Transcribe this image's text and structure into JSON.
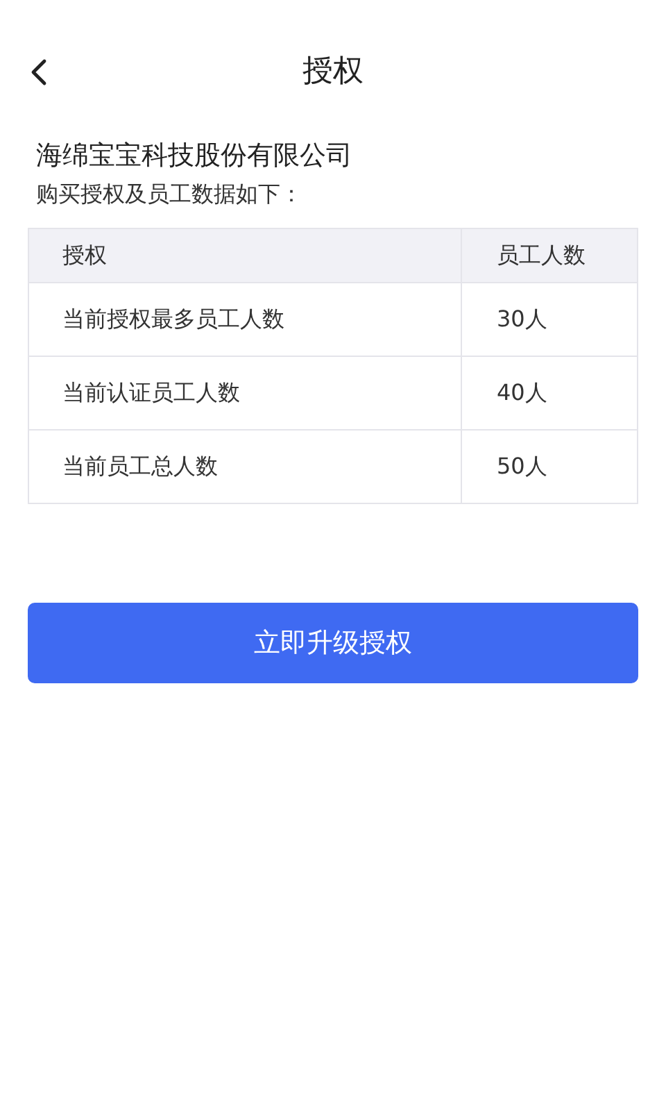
{
  "header": {
    "title": "授权"
  },
  "company": "海绵宝宝科技股份有限公司",
  "intro": "购买授权及员工数据如下：",
  "table": {
    "columns": [
      "授权",
      "员工人数"
    ],
    "rows": [
      [
        "当前授权最多员工人数",
        "30人"
      ],
      [
        "当前认证员工人数",
        "40人"
      ],
      [
        "当前员工总人数",
        "50人"
      ]
    ]
  },
  "button": "立即升级授权"
}
